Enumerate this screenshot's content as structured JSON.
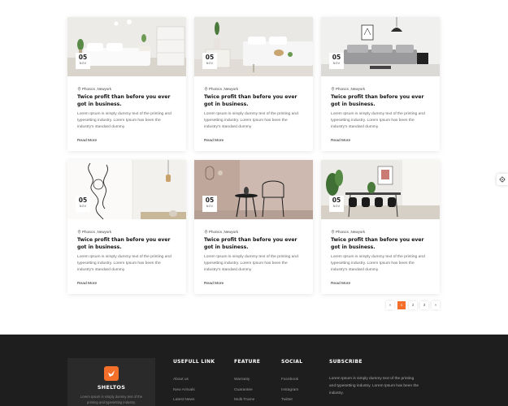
{
  "posts": [
    {
      "day": "05",
      "month": "NOV",
      "location": "Phonics ,Newyork",
      "title": "Twice profit than before you ever got in business.",
      "excerpt": "Lorem Ipsum is simply dummy text of the printing and typesetting industry. Lorem Ipsum has been the industry's standard dummy",
      "read_more": "Read More"
    },
    {
      "day": "05",
      "month": "NOV",
      "location": "Phonics ,Newyork",
      "title": "Twice profit than before you ever got in business.",
      "excerpt": "Lorem Ipsum is simply dummy text of the printing and typesetting industry. Lorem Ipsum has been the industry's standard dummy",
      "read_more": "Read More"
    },
    {
      "day": "05",
      "month": "NOV",
      "location": "Phonics ,Newyork",
      "title": "Twice profit than before you ever got in business.",
      "excerpt": "Lorem Ipsum is simply dummy text of the printing and typesetting industry. Lorem Ipsum has been the industry's standard dummy",
      "read_more": "Read More"
    },
    {
      "day": "05",
      "month": "NOV",
      "location": "Phonics ,Newyork",
      "title": "Twice profit than before you ever got in business.",
      "excerpt": "Lorem Ipsum is simply dummy text of the printing and typesetting industry. Lorem Ipsum has been the industry's standard dummy",
      "read_more": "Read More"
    },
    {
      "day": "05",
      "month": "NOV",
      "location": "Phonics ,Newyork",
      "title": "Twice profit than before you ever got in business.",
      "excerpt": "Lorem Ipsum is simply dummy text of the printing and typesetting industry. Lorem Ipsum has been the industry's standard dummy",
      "read_more": "Read More"
    },
    {
      "day": "05",
      "month": "NOV",
      "location": "Phonics ,Newyork",
      "title": "Twice profit than before you ever got in business.",
      "excerpt": "Lorem Ipsum is simply dummy text of the printing and typesetting industry. Lorem Ipsum has been the industry's standard dummy",
      "read_more": "Read More"
    }
  ],
  "pagination": {
    "prev": "«",
    "pages": [
      "1",
      "2",
      "3"
    ],
    "next": "»",
    "active": "1"
  },
  "colors": {
    "accent": "#f36f2a",
    "footer_bg": "#1e1e1e"
  },
  "footer": {
    "brand": {
      "name": "SHELTOS",
      "description": "Lorem Ipsum is simply dummy text of the printing and typesetting industry."
    },
    "useful_links": {
      "heading": "USEFULL LINK",
      "items": [
        "About us",
        "New Arrivals",
        "Latest News"
      ]
    },
    "feature": {
      "heading": "FEATURE",
      "items": [
        "Warranty",
        "Guarantee",
        "Multi Frame"
      ]
    },
    "social": {
      "heading": "SOCIAL",
      "items": [
        "Facebook",
        "Instagram",
        "Twitter"
      ]
    },
    "subscribe": {
      "heading": "SUBSCRIBE",
      "text": "Lorem Ipsum is simply dummy text of the printing and typesetting industry. Lorem Ipsum has been the industry."
    }
  }
}
